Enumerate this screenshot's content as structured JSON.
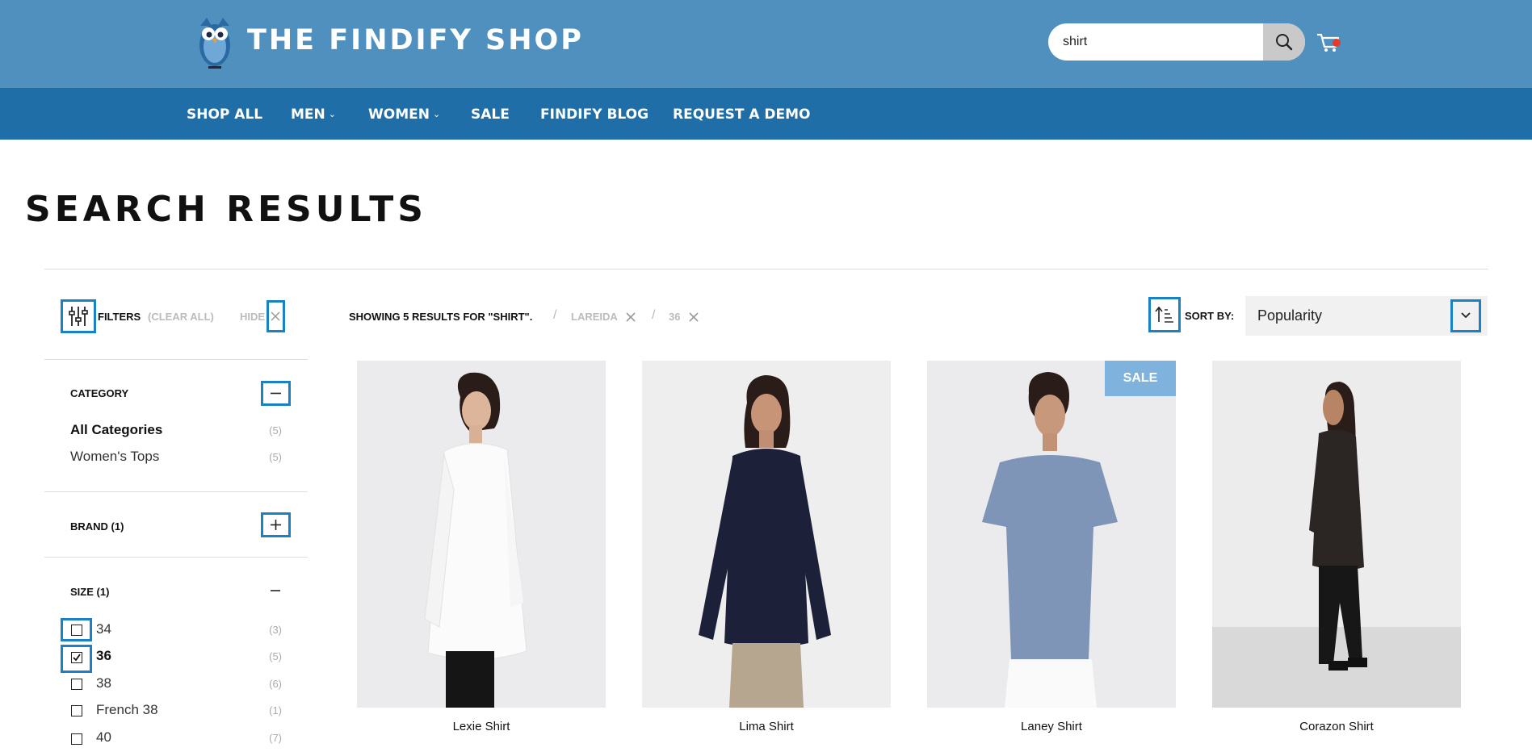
{
  "header": {
    "brand": "THE FINDIFY SHOP",
    "search_value": "shirt",
    "colors": {
      "top": "#4f90bf",
      "nav": "#1f6ea8",
      "accent": "#1a82c4"
    }
  },
  "nav": [
    {
      "label": "SHOP ALL",
      "has_dropdown": false
    },
    {
      "label": "MEN",
      "has_dropdown": true
    },
    {
      "label": "WOMEN",
      "has_dropdown": true
    },
    {
      "label": "SALE",
      "has_dropdown": false
    },
    {
      "label": "FINDIFY BLOG",
      "has_dropdown": false
    },
    {
      "label": "REQUEST A DEMO",
      "has_dropdown": false
    }
  ],
  "page_title": "SEARCH RESULTS",
  "filters": {
    "label": "FILTERS",
    "clear_all": "(CLEAR ALL)",
    "hide": "HIDE",
    "category": {
      "title": "CATEGORY",
      "items": [
        {
          "label": "All Categories",
          "count": "(5)",
          "selected": true
        },
        {
          "label": "Women's Tops",
          "count": "(5)",
          "selected": false
        }
      ]
    },
    "brand": {
      "title": "BRAND (1)"
    },
    "size": {
      "title": "SIZE (1)",
      "items": [
        {
          "label": "34",
          "count": "(3)",
          "checked": false
        },
        {
          "label": "36",
          "count": "(5)",
          "checked": true
        },
        {
          "label": "38",
          "count": "(6)",
          "checked": false
        },
        {
          "label": "French 38",
          "count": "(1)",
          "checked": false
        },
        {
          "label": "40",
          "count": "(7)",
          "checked": false
        }
      ]
    }
  },
  "results": {
    "summary": "SHOWING 5 RESULTS FOR \"SHIRT\".",
    "active_filters": [
      "LAREIDA",
      "36"
    ],
    "sort_label": "SORT BY:",
    "sort_value": "Popularity"
  },
  "products": [
    {
      "name": "Lexie Shirt",
      "sale": false,
      "shirt_color": "#fbfbfb"
    },
    {
      "name": "Lima Shirt",
      "sale": false,
      "shirt_color": "#1c2139"
    },
    {
      "name": "Laney Shirt",
      "sale": true,
      "badge": "SALE",
      "shirt_color": "#7f95b8"
    },
    {
      "name": "Corazon Shirt",
      "sale": false,
      "shirt_color": "#2b2624"
    }
  ]
}
